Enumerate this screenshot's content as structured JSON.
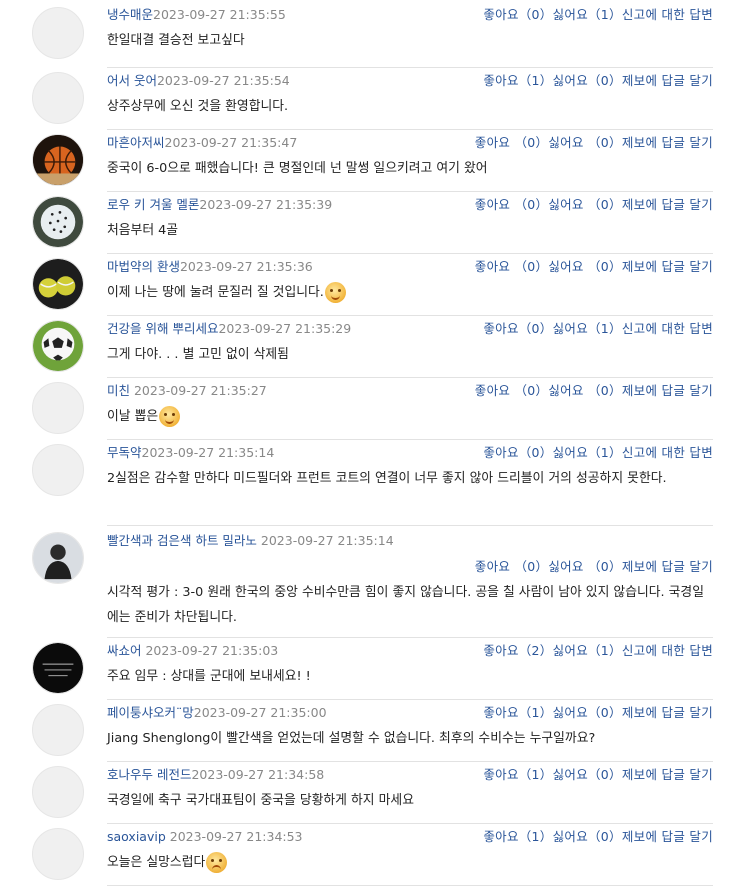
{
  "comments": [
    {
      "user": "냉수매운",
      "time": "2023-09-27 21:35:55",
      "actions": "좋아요（0）싫어요（1）신고에 대한 답변",
      "text": "한일대결 결승전 보고싶다",
      "avatar": "default-avatar"
    },
    {
      "user": "어서 웃어",
      "time": "2023-09-27 21:35:54",
      "actions": "좋아요（1）싫어요（0）제보에 답글 달기",
      "text": "상주상무에 오신 것을 환영합니다.",
      "avatar": "default-avatar"
    },
    {
      "user": "마흔아저씨",
      "time": "2023-09-27 21:35:47",
      "actions": "좋아요 （0）싫어요 （0）제보에 답글 달기",
      "text": "중국이 6-0으로 패했습니다! 큰 명절인데 넌 말썽 일으키려고 여기 왔어",
      "avatar": "basketball-avatar"
    },
    {
      "user": "로우 키 겨울 멜론",
      "time": "2023-09-27 21:35:39",
      "actions": "좋아요 （0）싫어요 （0）제보에 답글 달기",
      "text": "처음부터 4골",
      "avatar": "dotted-ball-avatar"
    },
    {
      "user": "마법약의 환생",
      "time": "2023-09-27 21:35:36",
      "actions": "좋아요 （0）싫어요 （0）제보에 답글 달기",
      "text": "이제 나는 땅에 눌려 문질러 질 것입니다.",
      "emoji": "smile-emoji",
      "avatar": "tennis-avatar"
    },
    {
      "user": "건강을 위해 뿌리세요",
      "time": "2023-09-27 21:35:29",
      "actions": "좋아요（0）싫어요（1）신고에 대한 답변",
      "text": "그게 다야. . . 별 고민 없이 삭제됨",
      "avatar": "soccer-avatar"
    },
    {
      "user": "미친 ",
      "time": "2023-09-27 21:35:27",
      "actions": "좋아요 （0）싫어요 （0）제보에 답글 달기",
      "text": "이날 뽑은",
      "emoji": "smile-emoji",
      "avatar": "default-avatar"
    },
    {
      "user": "무독약",
      "time": "2023-09-27 21:35:14",
      "actions": "좋아요（0）싫어요（1）신고에 대한 답변",
      "text": "2실점은 감수할 만하다 미드필더와 프런트 코트의 연결이 너무 좋지 않아 드리블이 거의 성공하지 못한다.",
      "avatar": "default-avatar"
    },
    {
      "user": "빨간색과 검은색 하트 밀라노 ",
      "time": "2023-09-27 21:35:14",
      "actions": "좋아요 （0）싫어요 （0）제보에 답글 달기",
      "text": "시각적 평가 : 3-0 원래 한국의 중앙 수비수만큼 힘이 좋지 않습니다. 공을 칠 사람이 남아 있지 않습니다. 국경일에는 준비가 차단됩니다.",
      "avatar": "person-avatar",
      "two_line_meta": true
    },
    {
      "user": "싸쇼어 ",
      "time": "2023-09-27 21:35:03",
      "actions": "좋아요（2）싫어요（1）신고에 대한 답변",
      "text": "주요 임무 : 상대를 군대에 보내세요! !",
      "avatar": "dark-avatar"
    },
    {
      "user": "페이퉁샤오커¨망",
      "time": "2023-09-27 21:35:00",
      "actions": "좋아요（1）싫어요（0）제보에 답글 달기",
      "text": "Jiang Shenglong이 빨간색을 얻었는데 설명할 수 없습니다. 최후의 수비수는 누구일까요?",
      "avatar": "default-avatar"
    },
    {
      "user": "호나우두 레전드",
      "time": "2023-09-27 21:34:58",
      "actions": "좋아요（1）싫어요（0）제보에 답글 달기",
      "text": "국경일에 축구 국가대표팀이 중국을 당황하게 하지 마세요",
      "avatar": "default-avatar"
    },
    {
      "user": "saoxiavip ",
      "time": "2023-09-27 21:34:53",
      "actions": "좋아요（1）싫어요（0）제보에 답글 달기",
      "text": "오늘은 실망스럽다",
      "emoji": "sad-emoji",
      "avatar": "default-avatar"
    }
  ]
}
